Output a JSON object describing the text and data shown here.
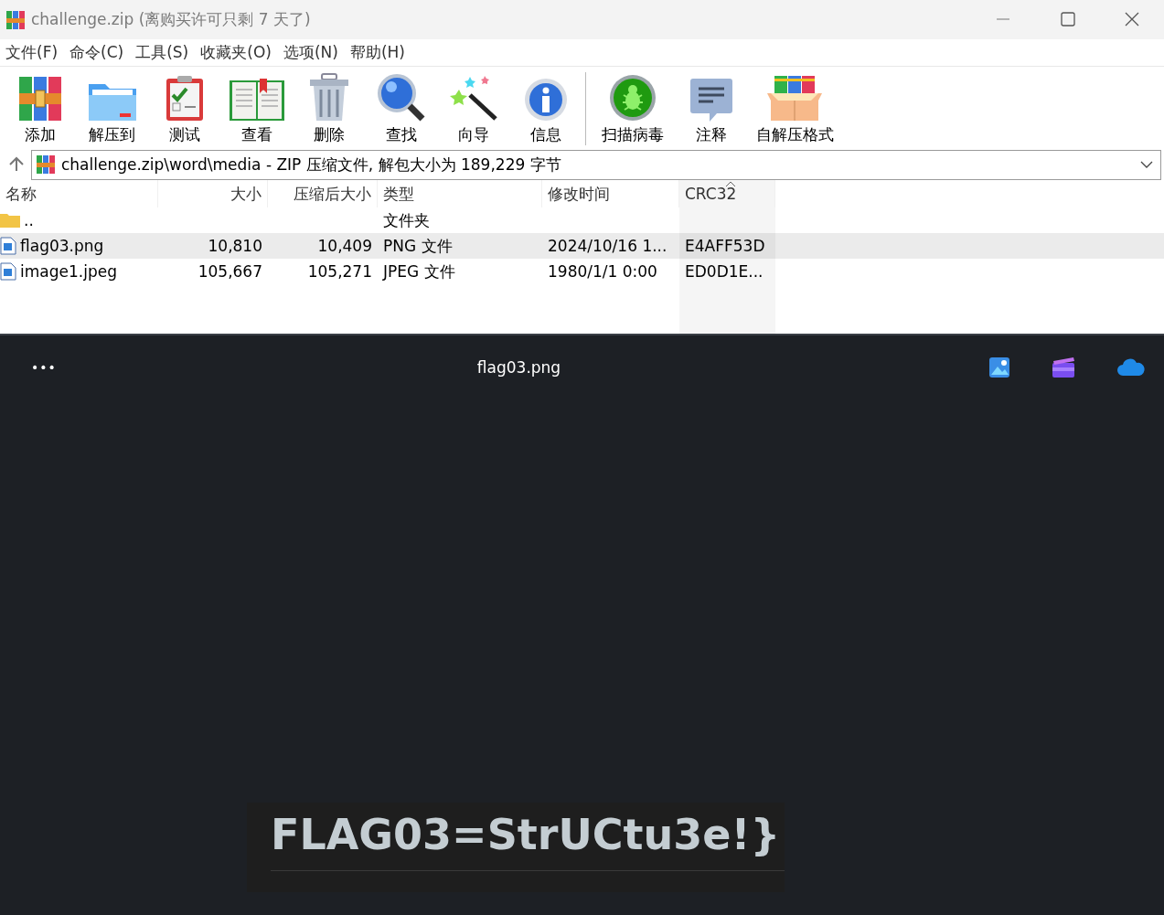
{
  "window": {
    "title": "challenge.zip (离购买许可只剩 7 天了)"
  },
  "menu": [
    "文件(F)",
    "命令(C)",
    "工具(S)",
    "收藏夹(O)",
    "选项(N)",
    "帮助(H)"
  ],
  "toolbar": [
    {
      "label": "添加",
      "kind": "add"
    },
    {
      "label": "解压到",
      "kind": "extract"
    },
    {
      "label": "测试",
      "kind": "test"
    },
    {
      "label": "查看",
      "kind": "view"
    },
    {
      "label": "删除",
      "kind": "delete"
    },
    {
      "label": "查找",
      "kind": "find"
    },
    {
      "label": "向导",
      "kind": "wizard"
    },
    {
      "label": "信息",
      "kind": "info"
    },
    {
      "label": "扫描病毒",
      "kind": "scan",
      "group_start": true
    },
    {
      "label": "注释",
      "kind": "comment"
    },
    {
      "label": "自解压格式",
      "kind": "sfx"
    }
  ],
  "address": {
    "value": "challenge.zip\\word\\media - ZIP 压缩文件, 解包大小为 189,229 字节"
  },
  "table": {
    "columns": [
      {
        "label": "名称",
        "sorted": false
      },
      {
        "label": "大小",
        "sorted": false
      },
      {
        "label": "压缩后大小",
        "sorted": false
      },
      {
        "label": "类型",
        "sorted": false
      },
      {
        "label": "修改时间",
        "sorted": false
      },
      {
        "label": "CRC32",
        "sorted": true
      }
    ],
    "rows": [
      {
        "kind": "folder",
        "selected": false,
        "cells": [
          "..",
          "",
          "",
          "文件夹",
          "",
          ""
        ]
      },
      {
        "kind": "file",
        "selected": true,
        "cells": [
          "flag03.png",
          "10,810",
          "10,409",
          "PNG 文件",
          "2024/10/16 1...",
          "E4AFF53D"
        ]
      },
      {
        "kind": "file",
        "selected": false,
        "cells": [
          "image1.jpeg",
          "105,667",
          "105,271",
          "JPEG 文件",
          "1980/1/1 0:00",
          "ED0D1E..."
        ]
      }
    ]
  },
  "viewer": {
    "title": "flag03.png",
    "more": "•••",
    "image_text": "FLAG03=StrUCtu3e!}"
  }
}
